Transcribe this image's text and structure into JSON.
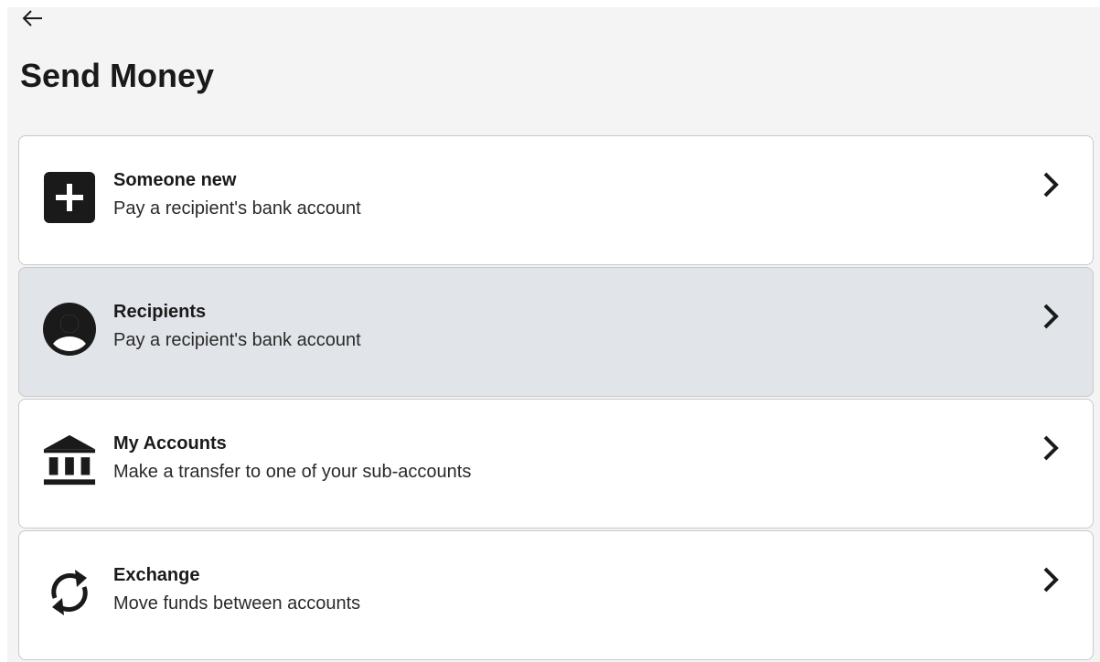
{
  "header": {
    "back_icon": "arrow-left-icon",
    "title": "Send Money"
  },
  "options": [
    {
      "icon": "plus-square-icon",
      "title": "Someone new",
      "description": "Pay a recipient's bank account",
      "highlighted": false
    },
    {
      "icon": "user-circle-icon",
      "title": "Recipients",
      "description": "Pay a recipient's bank account",
      "highlighted": true
    },
    {
      "icon": "bank-icon",
      "title": "My Accounts",
      "description": "Make a transfer to one of your sub-accounts",
      "highlighted": false
    },
    {
      "icon": "exchange-arrows-icon",
      "title": "Exchange",
      "description": "Move funds between accounts",
      "highlighted": false
    }
  ],
  "colors": {
    "page_background": "#f4f4f4",
    "card_background": "#ffffff",
    "card_hover_background": "#e1e4e8",
    "card_border": "#c9c9c9",
    "text_primary": "#1a1a1a"
  }
}
